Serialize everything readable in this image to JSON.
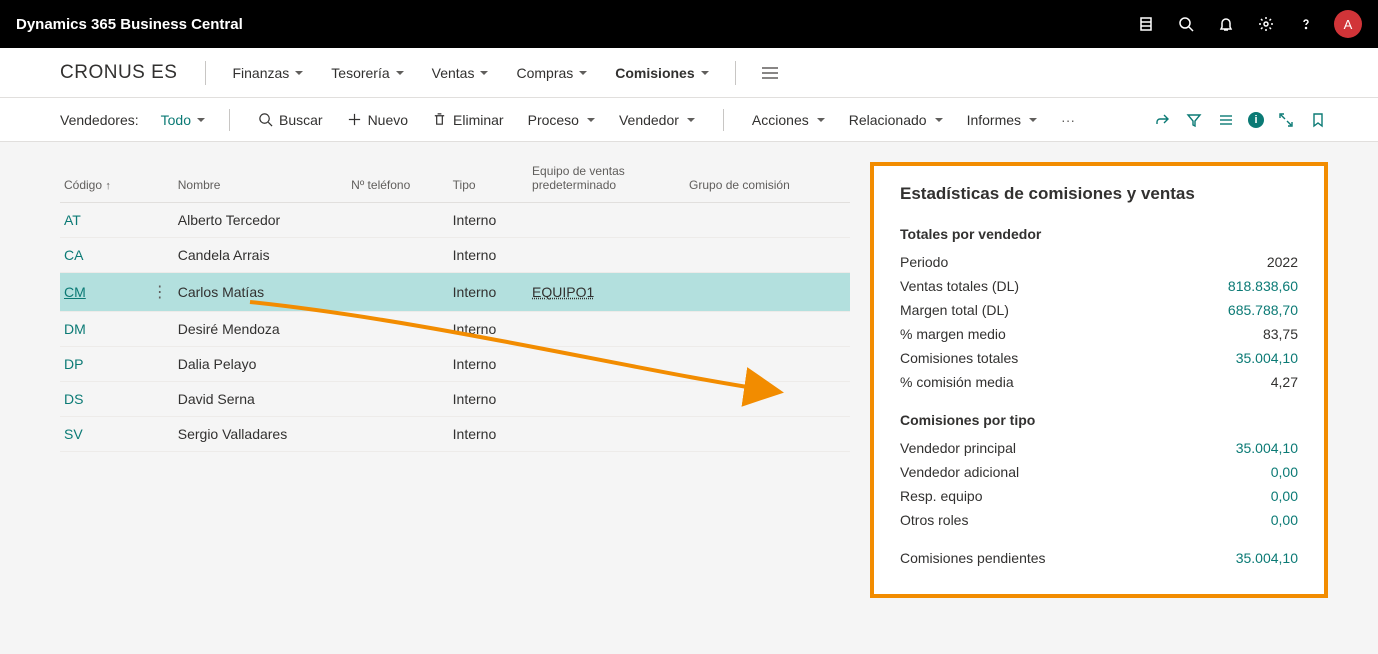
{
  "topbar": {
    "title": "Dynamics 365 Business Central",
    "avatar_initial": "A"
  },
  "navbar": {
    "company": "CRONUS ES",
    "items": [
      {
        "label": "Finanzas",
        "active": false
      },
      {
        "label": "Tesorería",
        "active": false
      },
      {
        "label": "Ventas",
        "active": false
      },
      {
        "label": "Compras",
        "active": false
      },
      {
        "label": "Comisiones",
        "active": true
      }
    ]
  },
  "toolbar": {
    "list_label": "Vendedores:",
    "filter_value": "Todo",
    "search": "Buscar",
    "new": "Nuevo",
    "delete": "Eliminar",
    "process": "Proceso",
    "vendor": "Vendedor",
    "actions": "Acciones",
    "related": "Relacionado",
    "reports": "Informes"
  },
  "table": {
    "columns": {
      "code": "Código",
      "name": "Nombre",
      "phone": "Nº teléfono",
      "type": "Tipo",
      "team": "Equipo de ventas predeterminado",
      "group": "Grupo de comisión"
    },
    "rows": [
      {
        "code": "AT",
        "name": "Alberto Tercedor",
        "phone": "",
        "type": "Interno",
        "team": "",
        "group": "",
        "selected": false
      },
      {
        "code": "CA",
        "name": "Candela Arrais",
        "phone": "",
        "type": "Interno",
        "team": "",
        "group": "",
        "selected": false
      },
      {
        "code": "CM",
        "name": "Carlos Matías",
        "phone": "",
        "type": "Interno",
        "team": "EQUIPO1",
        "group": "",
        "selected": true
      },
      {
        "code": "DM",
        "name": "Desiré Mendoza",
        "phone": "",
        "type": "Interno",
        "team": "",
        "group": "",
        "selected": false
      },
      {
        "code": "DP",
        "name": "Dalia Pelayo",
        "phone": "",
        "type": "Interno",
        "team": "",
        "group": "",
        "selected": false
      },
      {
        "code": "DS",
        "name": "David Serna",
        "phone": "",
        "type": "Interno",
        "team": "",
        "group": "",
        "selected": false
      },
      {
        "code": "SV",
        "name": "Sergio Valladares",
        "phone": "",
        "type": "Interno",
        "team": "",
        "group": "",
        "selected": false
      }
    ]
  },
  "factbox": {
    "title": "Estadísticas de comisiones y ventas",
    "section1_title": "Totales por vendedor",
    "period_label": "Periodo",
    "period_value": "2022",
    "total_sales_label": "Ventas totales (DL)",
    "total_sales_value": "818.838,60",
    "total_margin_label": "Margen total (DL)",
    "total_margin_value": "685.788,70",
    "avg_margin_label": "% margen medio",
    "avg_margin_value": "83,75",
    "total_comm_label": "Comisiones totales",
    "total_comm_value": "35.004,10",
    "avg_comm_label": "% comisión media",
    "avg_comm_value": "4,27",
    "section2_title": "Comisiones por tipo",
    "main_seller_label": "Vendedor principal",
    "main_seller_value": "35.004,10",
    "add_seller_label": "Vendedor adicional",
    "add_seller_value": "0,00",
    "team_resp_label": "Resp. equipo",
    "team_resp_value": "0,00",
    "other_roles_label": "Otros roles",
    "other_roles_value": "0,00",
    "pending_label": "Comisiones pendientes",
    "pending_value": "35.004,10"
  }
}
